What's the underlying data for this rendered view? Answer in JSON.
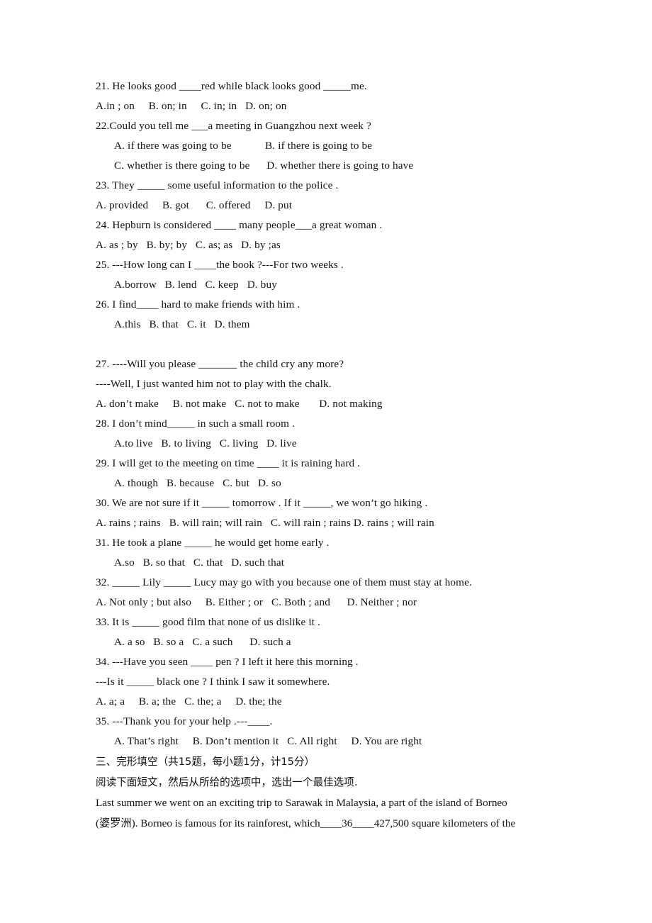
{
  "document": {
    "type": "english-exam-paper",
    "page_background": "#ffffff",
    "text_color": "#121212"
  },
  "questions": [
    {
      "id": "q21",
      "stem": "21. He looks good ____red while black looks good _____me.",
      "options_lines": [
        {
          "text": "A.in ; on     B. on; in     C. in; in   D. on; on",
          "indent": false
        }
      ]
    },
    {
      "id": "q22",
      "stem": "22.Could you tell me ___a meeting in Guangzhou next week ?",
      "options_lines": [
        {
          "text": "A. if there was going to be            B. if there is going to be",
          "indent": true
        },
        {
          "text": "C. whether is there going to be      D. whether there is going to have",
          "indent": true
        }
      ]
    },
    {
      "id": "q23",
      "stem": "23. They _____ some useful information to the police .",
      "options_lines": [
        {
          "text": "A. provided     B. got      C. offered     D. put",
          "indent": false
        }
      ]
    },
    {
      "id": "q24",
      "stem": "24. Hepburn is considered ____ many people___a great woman .",
      "options_lines": [
        {
          "text": "A. as ; by   B. by; by   C. as; as   D. by ;as",
          "indent": false
        }
      ]
    },
    {
      "id": "q25",
      "stem": "25. ---How long can I ____the book ?---For two weeks .",
      "options_lines": [
        {
          "text": "A.borrow   B. lend   C. keep   D. buy",
          "indent": true
        }
      ]
    },
    {
      "id": "q26",
      "stem": "26. I find____ hard to make friends with him .",
      "options_lines": [
        {
          "text": "A.this   B. that   C. it   D. them",
          "indent": true
        }
      ]
    },
    {
      "id": "q27",
      "stem": "27. ----Will you please _______ the child cry any more?",
      "extra_stem_lines": [
        "----Well, I just wanted him not to play with the chalk."
      ],
      "options_lines": [
        {
          "text": "A. don’t make     B. not make   C. not to make       D. not making",
          "indent": false
        }
      ],
      "gap_before": true
    },
    {
      "id": "q28",
      "stem": "28. I don’t mind_____ in such a small room .",
      "options_lines": [
        {
          "text": "A.to live   B. to living   C. living   D. live",
          "indent": true
        }
      ]
    },
    {
      "id": "q29",
      "stem": "29. I will get to the meeting on time ____ it is raining hard .",
      "options_lines": [
        {
          "text": "A. though   B. because   C. but   D. so",
          "indent": true
        }
      ]
    },
    {
      "id": "q30",
      "stem": "30. We are not sure if it _____ tomorrow . If it _____, we won’t go hiking .",
      "options_lines": [
        {
          "text": "A. rains ; rains   B. will rain; will rain   C. will rain ; rains D. rains ; will rain",
          "indent": false
        }
      ]
    },
    {
      "id": "q31",
      "stem": "31. He took a plane _____ he would get home early .",
      "options_lines": [
        {
          "text": "A.so   B. so that   C. that   D. such that",
          "indent": true
        }
      ]
    },
    {
      "id": "q32",
      "stem": "32. _____ Lily _____ Lucy may go with you because one of them must stay at home.",
      "options_lines": [
        {
          "text": "A. Not only ; but also     B. Either ; or   C. Both ; and      D. Neither ; nor",
          "indent": false
        }
      ]
    },
    {
      "id": "q33",
      "stem": "33. It is _____ good film that none of us dislike it .",
      "options_lines": [
        {
          "text": "A. a so   B. so a   C. a such      D. such a",
          "indent": true
        }
      ]
    },
    {
      "id": "q34",
      "stem": "34. ---Have you seen ____ pen ? I left it here this morning .",
      "extra_stem_lines": [
        "---Is it _____ black one ? I think I saw it somewhere."
      ],
      "options_lines": [
        {
          "text": "A. a; a     B. a; the   C. the; a     D. the; the",
          "indent": false
        }
      ]
    },
    {
      "id": "q35",
      "stem": "35. ---Thank you for your help .---____.",
      "options_lines": [
        {
          "text": "A. That’s right     B. Don’t mention it   C. All right     D. You are right",
          "indent": true
        }
      ]
    }
  ],
  "cloze_section": {
    "heading": "三、完形填空（共15题，每小题1分，计15分）",
    "instruction": "阅读下面短文，然后从所给的选项中，选出一个最佳选项.",
    "passage_lines": [
      "Last summer we went on an exciting trip to Sarawak in Malaysia, a part of the island of Borneo",
      "(婆罗洲). Borneo is famous for its rainforest, which____36____427,500 square kilometers of the"
    ]
  }
}
